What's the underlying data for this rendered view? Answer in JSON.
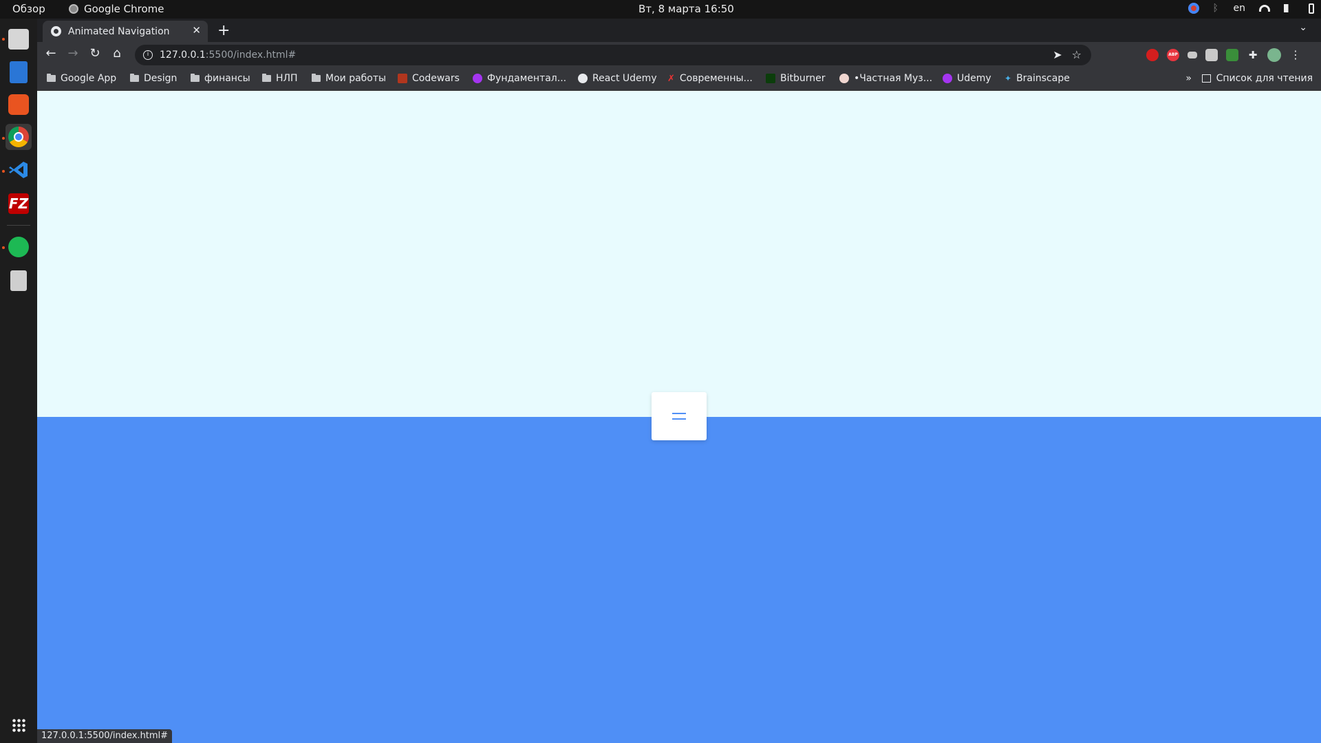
{
  "topbar": {
    "activities": "Обзор",
    "app_name": "Google Chrome",
    "clock": "Вт, 8 марта  16:50",
    "lang": "en"
  },
  "dock": {
    "apps": [
      "files-icon",
      "document-icon",
      "software-store-icon",
      "chrome-icon",
      "vscode-icon",
      "filezilla-icon",
      "spotify-icon",
      "trash-icon"
    ],
    "filezilla_label": "FZ"
  },
  "browser": {
    "tab": {
      "title": "Animated Navigation"
    },
    "address": {
      "host": "127.0.0.1",
      "path": ":5500/index.html#"
    },
    "bookmarks": [
      {
        "label": "Google App",
        "icon": "folder-icon"
      },
      {
        "label": "Design",
        "icon": "folder-icon"
      },
      {
        "label": "финансы",
        "icon": "folder-icon"
      },
      {
        "label": "НЛП",
        "icon": "folder-icon"
      },
      {
        "label": "Мои работы",
        "icon": "folder-icon"
      },
      {
        "label": "Codewars",
        "icon": "codewars-icon"
      },
      {
        "label": "Фундаментал...",
        "icon": "udemy-icon"
      },
      {
        "label": "React Udemy",
        "icon": "globe-icon"
      },
      {
        "label": "Современны...",
        "icon": "x-icon"
      },
      {
        "label": "Bitburner",
        "icon": "bitburner-icon"
      },
      {
        "label": "•Частная Муз...",
        "icon": "music-icon"
      },
      {
        "label": "Udemy",
        "icon": "udemy-icon"
      },
      {
        "label": "Brainscape",
        "icon": "brainscape-icon"
      }
    ],
    "bookmarks_more": "»",
    "reading_list": "Список для чтения",
    "status_url": "127.0.0.1:5500/index.html#"
  },
  "colors": {
    "page_top": "#e8fbfe",
    "page_bottom": "#4f8ff6",
    "toggle_bg": "#ffffff"
  }
}
